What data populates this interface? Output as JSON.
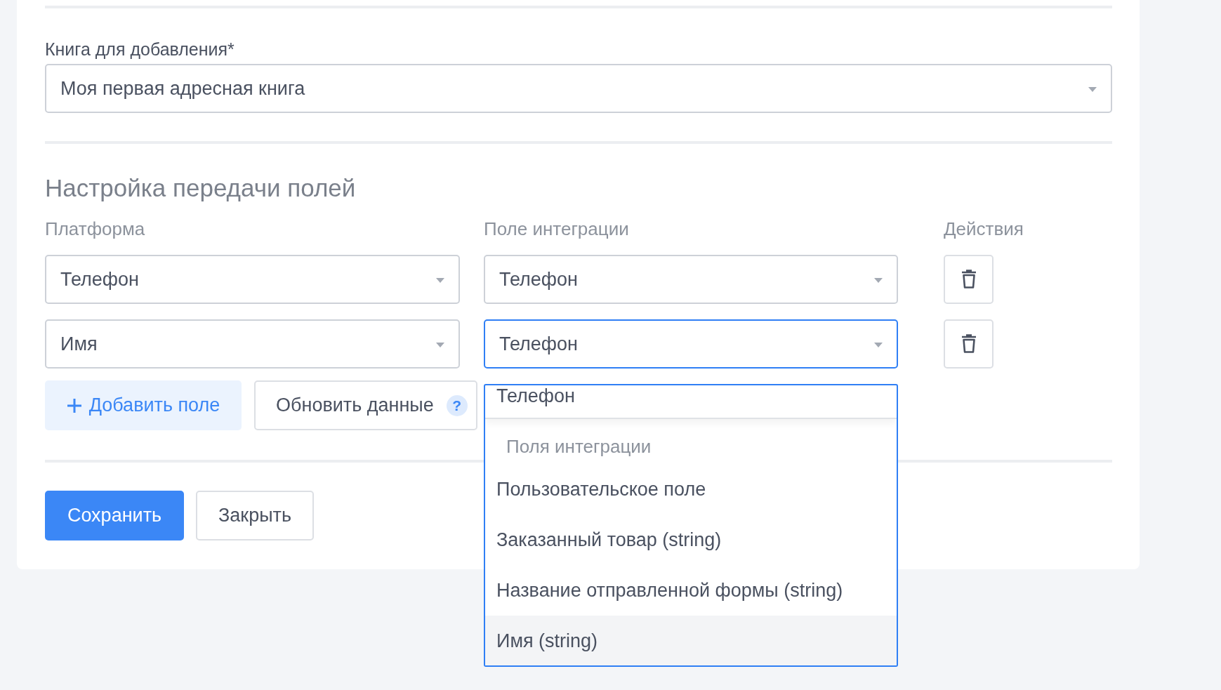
{
  "book": {
    "label": "Книга для добавления*",
    "value": "Моя первая адресная книга"
  },
  "mapping": {
    "title": "Настройка передачи полей",
    "columns": [
      "Платформа",
      "Поле интеграции",
      "Действия"
    ],
    "rows": [
      {
        "platform": "Телефон",
        "integration": "Телефон",
        "focused": false
      },
      {
        "platform": "Имя",
        "integration": "Телефон",
        "focused": true
      }
    ],
    "add_button": "Добавить поле",
    "refresh_button": "Обновить данные",
    "help": "?"
  },
  "dropdown": {
    "items": [
      {
        "kind": "current",
        "label": "Телефон"
      },
      {
        "kind": "group",
        "label": "Поля интеграции"
      },
      {
        "kind": "option",
        "label": "Пользовательское поле",
        "hovered": false
      },
      {
        "kind": "option",
        "label": "Заказанный товар (string)",
        "hovered": false
      },
      {
        "kind": "option",
        "label": "Название отправленной формы (string)",
        "hovered": false
      },
      {
        "kind": "option",
        "label": "Имя (string)",
        "hovered": true
      }
    ]
  },
  "buttons": [
    {
      "kind": "primary",
      "label": "Сохранить"
    },
    {
      "kind": "secondary",
      "label": "Закрыть"
    }
  ]
}
